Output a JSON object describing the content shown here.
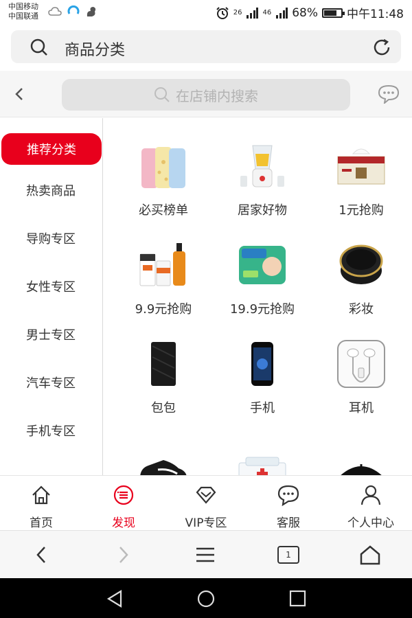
{
  "status_bar": {
    "carrier1": "中国移动",
    "carrier2": "中国联通",
    "net1": "26",
    "net2": "46",
    "battery": "68%",
    "battery_level": 0.68,
    "time": "中午11:48"
  },
  "browser_bar": {
    "query": "商品分类",
    "icons": [
      "search-icon",
      "reload-icon"
    ]
  },
  "store_header": {
    "search_placeholder": "在店铺内搜索",
    "icons": [
      "back-icon",
      "search-icon",
      "chat-icon"
    ]
  },
  "sidebar": {
    "items": [
      {
        "label": "推荐分类",
        "active": true
      },
      {
        "label": "热卖商品"
      },
      {
        "label": "导购专区"
      },
      {
        "label": "女性专区"
      },
      {
        "label": "男士专区"
      },
      {
        "label": "汽车专区"
      },
      {
        "label": "手机专区"
      }
    ]
  },
  "categories": [
    {
      "label": "必买榜单",
      "icon": "baby-clothes-image"
    },
    {
      "label": "居家好物",
      "icon": "blender-image"
    },
    {
      "label": "1元抢购",
      "icon": "tissue-box-image"
    },
    {
      "label": "9.9元抢购",
      "icon": "skincare-bottles-image"
    },
    {
      "label": "19.9元抢购",
      "icon": "diapers-pack-image"
    },
    {
      "label": "彩妆",
      "icon": "cushion-compact-image"
    },
    {
      "label": "包包",
      "icon": "wallet-image"
    },
    {
      "label": "手机",
      "icon": "smartphone-image"
    },
    {
      "label": "耳机",
      "icon": "earphones-image"
    },
    {
      "label": "",
      "icon": "sneaker-image"
    },
    {
      "label": "",
      "icon": "medicine-box-image"
    },
    {
      "label": "",
      "icon": "umbrella-image"
    }
  ],
  "bottom_nav": {
    "items": [
      {
        "label": "首页",
        "icon": "home-icon"
      },
      {
        "label": "发现",
        "icon": "discover-icon",
        "active": true
      },
      {
        "label": "VIP专区",
        "icon": "diamond-icon"
      },
      {
        "label": "客服",
        "icon": "chat-bubble-icon"
      },
      {
        "label": "个人中心",
        "icon": "user-icon"
      }
    ]
  },
  "browser_nav": {
    "tab_count": "1",
    "icons": [
      "back-arrow-icon",
      "forward-arrow-icon",
      "menu-icon",
      "tabs-icon",
      "home-icon"
    ]
  },
  "android_nav": {
    "icons": [
      "back-triangle-icon",
      "home-circle-icon",
      "recents-square-icon"
    ]
  },
  "colors": {
    "accent": "#e8001c",
    "sidebar_bg": "#ffffff",
    "header_bg": "#f6f6f6"
  }
}
